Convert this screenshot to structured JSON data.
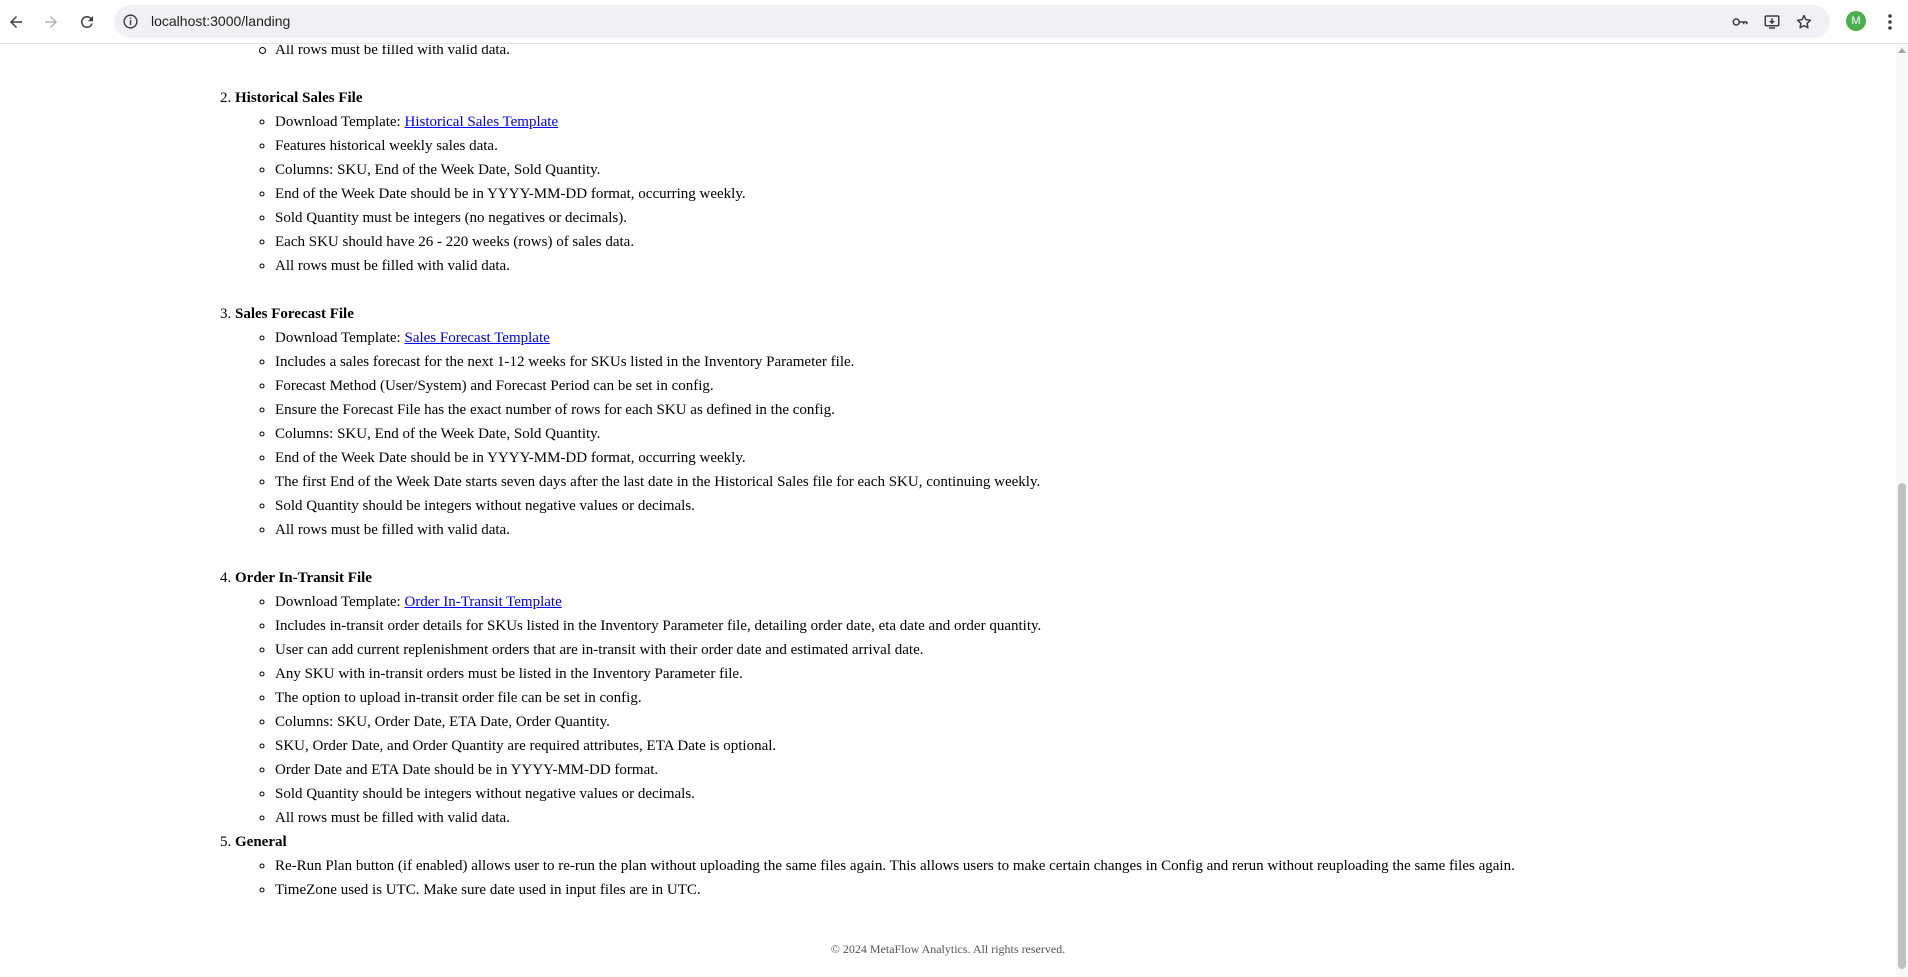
{
  "browser": {
    "url": "localhost:3000/landing",
    "profile_initial": "M",
    "icons": [
      "back-icon",
      "forward-icon",
      "reload-icon",
      "site-info-icon",
      "password-key-icon",
      "install-app-icon",
      "bookmark-star-icon",
      "menu-dots-icon"
    ]
  },
  "top_remnant": "All rows must be filled with valid data.",
  "sections": [
    {
      "number": "2.",
      "title": "Historical Sales File",
      "download_prefix": "Download Template: ",
      "download_link": "Historical Sales Template",
      "items": [
        "Features historical weekly sales data.",
        "Columns: SKU, End of the Week Date, Sold Quantity.",
        "End of the Week Date should be in YYYY-MM-DD format, occurring weekly.",
        "Sold Quantity must be integers (no negatives or decimals).",
        "Each SKU should have 26 - 220 weeks (rows) of sales data.",
        "All rows must be filled with valid data."
      ]
    },
    {
      "number": "3.",
      "title": "Sales Forecast File",
      "download_prefix": "Download Template: ",
      "download_link": "Sales Forecast Template",
      "items": [
        "Includes a sales forecast for the next 1-12 weeks for SKUs listed in the Inventory Parameter file.",
        "Forecast Method (User/System) and Forecast Period can be set in config.",
        "Ensure the Forecast File has the exact number of rows for each SKU as defined in the config.",
        "Columns: SKU, End of the Week Date, Sold Quantity.",
        "End of the Week Date should be in YYYY-MM-DD format, occurring weekly.",
        "The first End of the Week Date starts seven days after the last date in the Historical Sales file for each SKU, continuing weekly.",
        "Sold Quantity should be integers without negative values or decimals.",
        "All rows must be filled with valid data."
      ]
    },
    {
      "number": "4.",
      "title": "Order In-Transit File",
      "download_prefix": "Download Template: ",
      "download_link": "Order In-Transit Template",
      "items": [
        "Includes in-transit order details for SKUs listed in the Inventory Parameter file, detailing order date, eta date and order quantity.",
        "User can add current replenishment orders that are in-transit with their order date and estimated arrival date.",
        "Any SKU with in-transit orders must be listed in the Inventory Parameter file.",
        "The option to upload in-transit order file can be set in config.",
        "Columns: SKU, Order Date, ETA Date, Order Quantity.",
        "SKU, Order Date, and Order Quantity are required attributes, ETA Date is optional.",
        "Order Date and ETA Date should be in YYYY-MM-DD format.",
        "Sold Quantity should be integers without negative values or decimals.",
        "All rows must be filled with valid data."
      ]
    },
    {
      "number": "5.",
      "title": "General",
      "items": [
        "Re-Run Plan button (if enabled) allows user to re-run the plan without uploading the same files again. This allows users to make certain changes in Config and rerun without reuploading the same files again.",
        "TimeZone used is UTC. Make sure date used in input files are in UTC."
      ]
    }
  ],
  "footer": "© 2024 MetaFlow Analytics. All rights reserved."
}
